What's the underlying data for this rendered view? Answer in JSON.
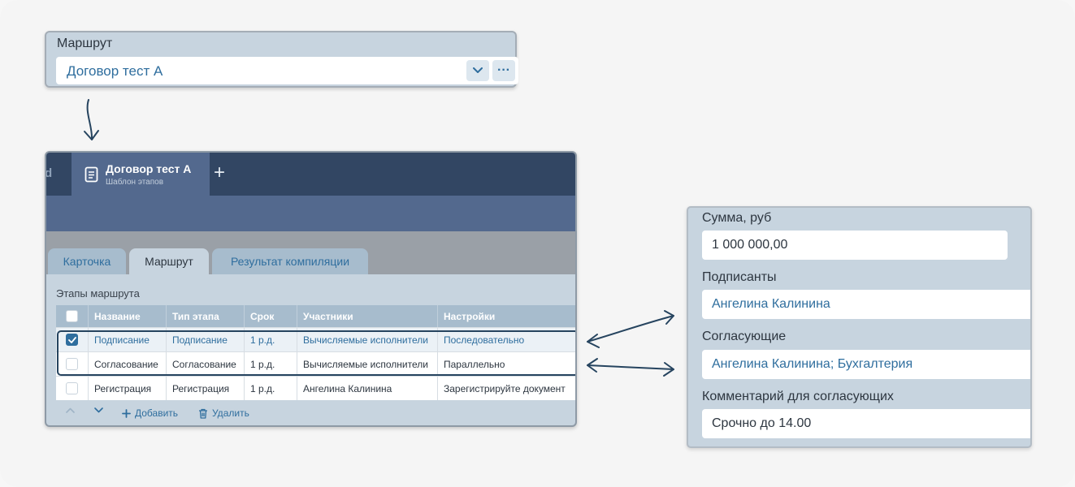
{
  "colors": {
    "accent": "#2f6e9e",
    "tabbar": "#324663",
    "active_tab": "#53698e",
    "panel": "#c7d4df",
    "highlight_border": "#26445f"
  },
  "route_field": {
    "label": "Маршрут",
    "value": "Договор тест А",
    "dropdown_icon": "chevron-down-icon",
    "more_icon": "more-horizontal-icon",
    "more_label": "···"
  },
  "app": {
    "previous_tab_fragment": "d",
    "active_tab": {
      "title": "Договор тест А",
      "subtitle": "Шаблон этапов",
      "icon": "document-icon"
    },
    "add_tab_label": "+",
    "section_tabs": [
      {
        "label": "Карточка"
      },
      {
        "label": "Маршрут"
      },
      {
        "label": "Результат компиляции"
      }
    ],
    "stages_title": "Этапы маршрута",
    "columns": [
      "Название",
      "Тип этапа",
      "Срок",
      "Участники",
      "Настройки"
    ],
    "rows": [
      {
        "checked": true,
        "name": "Подписание",
        "type": "Подписание",
        "term": "1 р.д.",
        "participants": "Вычисляемые исполнители",
        "settings": "Последовательно"
      },
      {
        "checked": false,
        "name": "Согласование",
        "type": "Согласование",
        "term": "1 р.д.",
        "participants": "Вычисляемые исполнители",
        "settings": "Параллельно"
      },
      {
        "checked": false,
        "name": "Регистрация",
        "type": "Регистрация",
        "term": "1 р.д.",
        "participants": "Ангелина Калинина",
        "settings": "Зарегистрируйте документ"
      }
    ],
    "toolbar": {
      "up_icon": "chevron-up-icon",
      "down_icon": "chevron-down-icon",
      "add_label": "Добавить",
      "delete_label": "Удалить"
    }
  },
  "details": {
    "amount_label": "Сумма, руб",
    "amount_value": "1 000 000,00",
    "signers_label": "Подписанты",
    "signers_value": "Ангелина Калинина",
    "approvers_label": "Согласующие",
    "approvers_value": "Ангелина Калинина; Бухгалтерия",
    "comment_label": "Комментарий для согласующих",
    "comment_value": "Срочно до 14.00"
  }
}
